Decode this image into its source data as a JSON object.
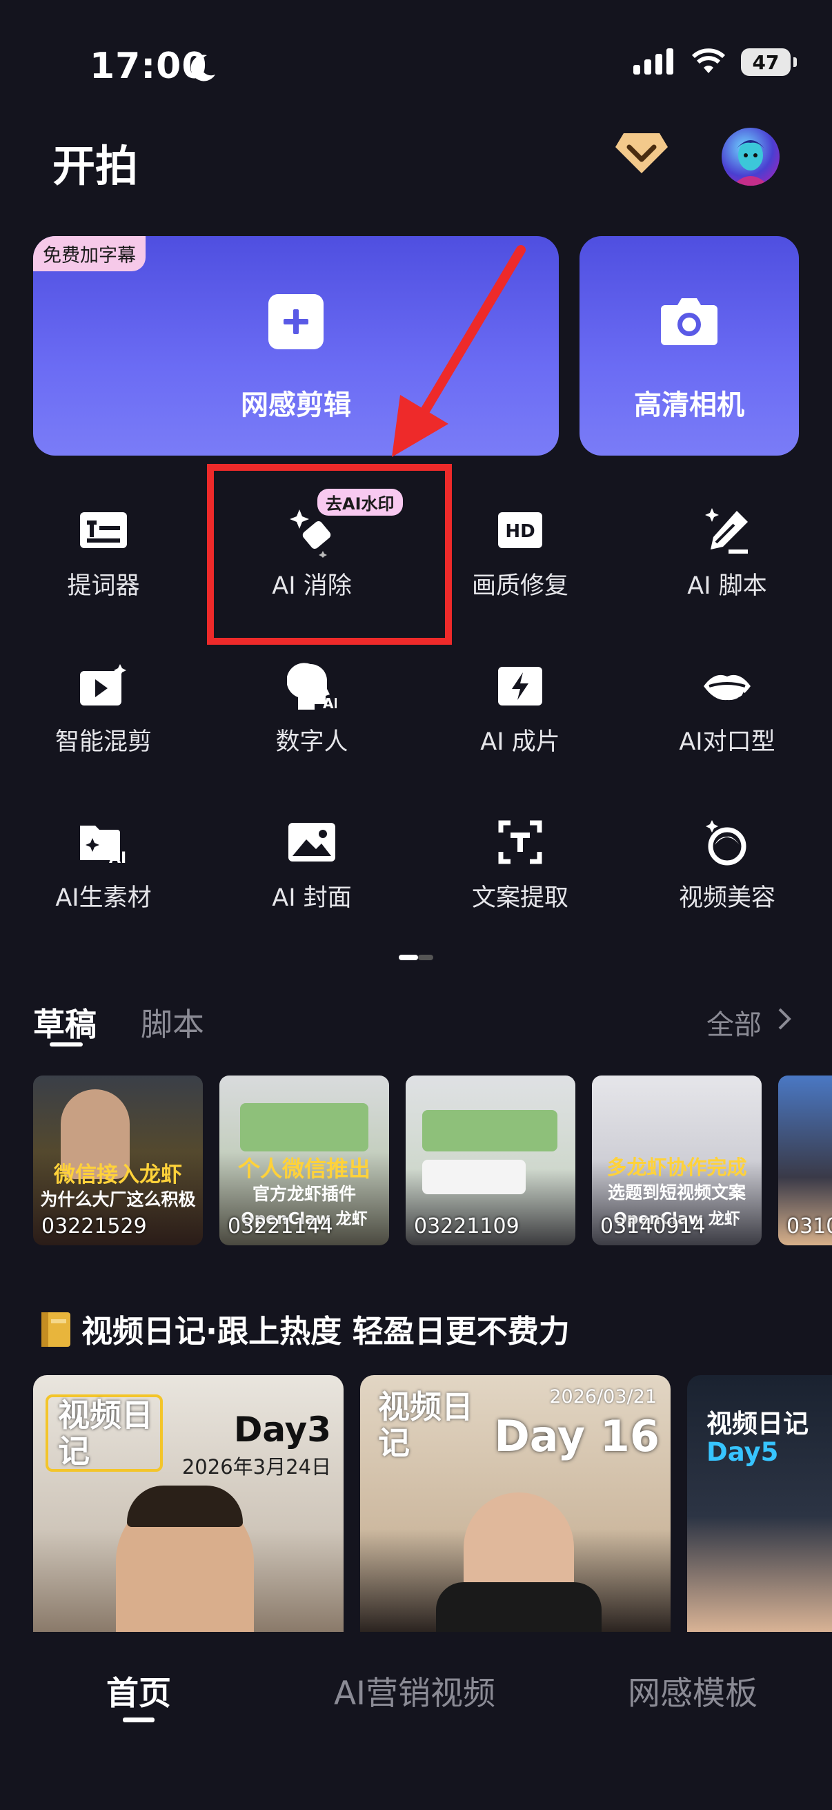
{
  "status": {
    "time": "17:00",
    "battery": "47"
  },
  "header": {
    "title": "开拍"
  },
  "hero": {
    "free_tag": "免费加字幕",
    "edit_label": "网感剪辑",
    "camera_label": "高清相机"
  },
  "tools": {
    "ai_badge": "去AI水印",
    "items": [
      {
        "label": "提词器",
        "icon": "teleprompter-icon"
      },
      {
        "label": "AI 消除",
        "icon": "eraser-icon"
      },
      {
        "label": "画质修复",
        "icon": "hd-icon"
      },
      {
        "label": "AI 脚本",
        "icon": "pen-sparkle-icon"
      },
      {
        "label": "智能混剪",
        "icon": "play-sparkle-icon"
      },
      {
        "label": "数字人",
        "icon": "digital-human-icon"
      },
      {
        "label": "AI 成片",
        "icon": "bolt-icon"
      },
      {
        "label": "AI对口型",
        "icon": "lips-icon"
      },
      {
        "label": "AI生素材",
        "icon": "folder-ai-icon"
      },
      {
        "label": "AI 封面",
        "icon": "image-icon"
      },
      {
        "label": "文案提取",
        "icon": "text-extract-icon"
      },
      {
        "label": "视频美容",
        "icon": "face-beauty-icon"
      }
    ]
  },
  "drafts": {
    "tab_drafts": "草稿",
    "tab_scripts": "脚本",
    "see_all": "全部",
    "items": [
      {
        "line1": "微信接入龙虾",
        "line2": "为什么大厂这么积极",
        "id": "03221529"
      },
      {
        "line1": "个人微信推出",
        "line2": "官方龙虾插件",
        "line3": "OpenClaw 龙虾",
        "id": "03221144"
      },
      {
        "line1": "",
        "line2": "",
        "id": "03221109"
      },
      {
        "line1": "多龙虾协作完成",
        "line2": "选题到短视频文案",
        "line3": "OpenClaw 龙虾",
        "id": "03140914"
      },
      {
        "line1": "",
        "line2": "",
        "id": "0310"
      }
    ]
  },
  "diary": {
    "title": "视频日记·跟上热度 轻盈日更不费力",
    "cards": [
      {
        "tag": "视频日记",
        "day": "Day3",
        "date": "2026年3月24日"
      },
      {
        "tag": "视频日记",
        "day": "Day 16",
        "date": "2026/03/21"
      },
      {
        "tag": "视频日记",
        "day": "Day5",
        "date": ""
      }
    ]
  },
  "nav": {
    "home": "首页",
    "ai_marketing": "AI营销视频",
    "templates": "网感模板"
  }
}
